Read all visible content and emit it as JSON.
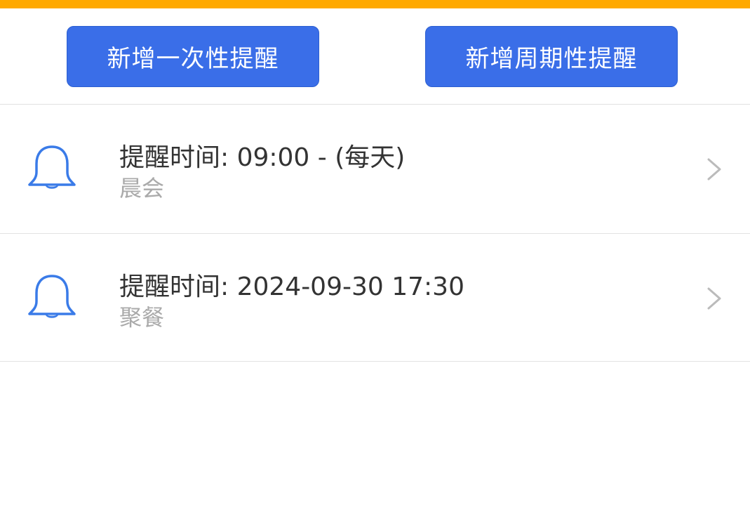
{
  "colors": {
    "top_bar": "#FFA900",
    "button_bg": "#3A6EE8",
    "accent": "#3A7BE8",
    "chevron": "#bbbbbb"
  },
  "actions": {
    "add_once_label": "新增一次性提醒",
    "add_periodic_label": "新增周期性提醒"
  },
  "reminders": [
    {
      "icon": "bell-icon",
      "time_text": "提醒时间: 09:00 - (每天)",
      "title": "晨会"
    },
    {
      "icon": "bell-icon",
      "time_text": "提醒时间: 2024-09-30 17:30",
      "title": "聚餐"
    }
  ]
}
